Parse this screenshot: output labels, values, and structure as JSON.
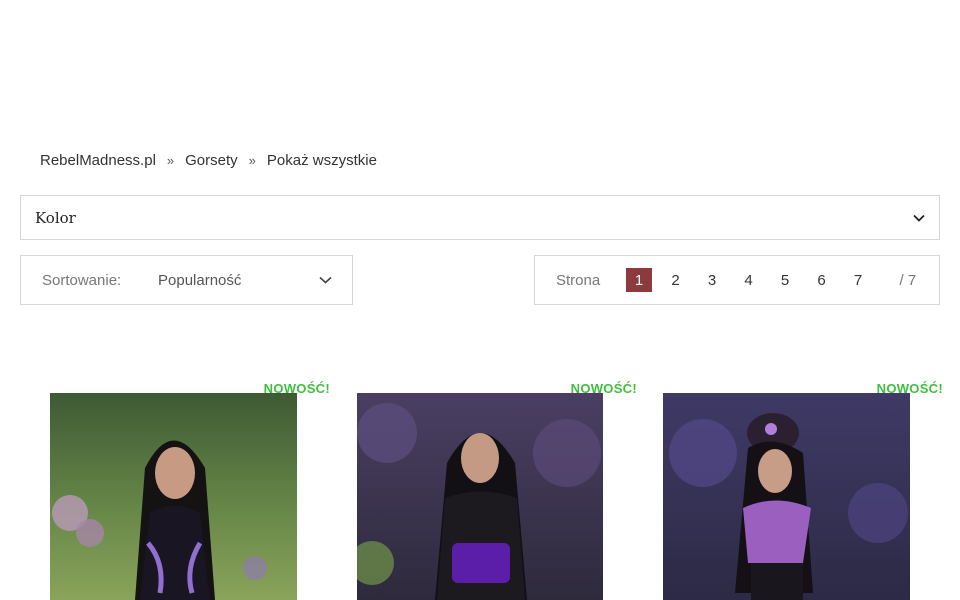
{
  "breadcrumb": {
    "items": [
      "RebelMadness.pl",
      "Gorsety",
      "Pokaż wszystkie"
    ],
    "separator": "»"
  },
  "filter": {
    "color_label": "Kolor"
  },
  "sort": {
    "label": "Sortowanie:",
    "value": "Popularność"
  },
  "pagination": {
    "label": "Strona",
    "pages": [
      "1",
      "2",
      "3",
      "4",
      "5",
      "6",
      "7"
    ],
    "current": "1",
    "total": "/ 7"
  },
  "products": [
    {
      "badge": "NOWOŚĆ!"
    },
    {
      "badge": "NOWOŚĆ!"
    },
    {
      "badge": "NOWOŚĆ!"
    }
  ],
  "colors": {
    "accent": "#8b3a3e",
    "badge": "#3fbf3f",
    "border": "#d6d6d6"
  }
}
